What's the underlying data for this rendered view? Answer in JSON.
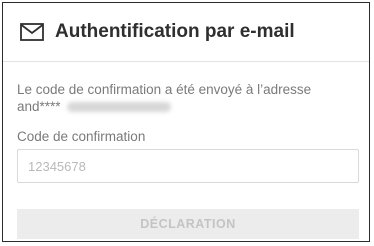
{
  "dialog": {
    "title": "Authentification par e-mail",
    "description_line1": "Le code de confirmation a été envoyé à l’adresse",
    "masked_email_prefix": "and****",
    "code_label": "Code de confirmation",
    "code_value": "",
    "code_placeholder": "12345678",
    "submit_label": "DÉCLARATION",
    "icons": {
      "header": "mail-icon"
    },
    "colors": {
      "title": "#2f2f2f",
      "secondary_text": "#7a7a7a",
      "button_bg_disabled": "#ececec",
      "button_text_disabled": "#c4c4c4",
      "border": "#2b2b2b"
    }
  }
}
